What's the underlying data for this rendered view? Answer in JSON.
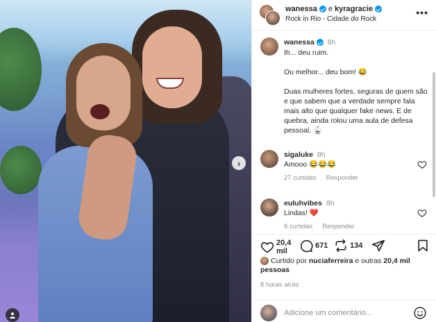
{
  "header": {
    "user1": "wanessa",
    "connector": "e",
    "user2": "kyragracie",
    "location": "Rock in Rio - Cidade do Rock",
    "more_icon": "more-horizontal-icon"
  },
  "caption": {
    "username": "wanessa",
    "time": "8h",
    "lines": [
      "Ih... deu ruim.",
      "Ou melhor... deu bom! 😂",
      "Duas mulheres fortes, seguras de quem são e que sabem que a verdade sempre fala mais alto que qualquer fake news. E de quebra, ainda rolou uma aula de defesa pessoal. 🥋"
    ]
  },
  "comments": [
    {
      "username": "sigaluke",
      "time": "8h",
      "text": "Amooo 😂😂😂",
      "likes": "27 curtidas",
      "reply": "Responder"
    },
    {
      "username": "euluhvibes",
      "time": "8h",
      "text": "Lindas! ❤️",
      "likes": "8 curtidas",
      "reply": "Responder"
    }
  ],
  "actions": {
    "likes_count": "20,4 mil",
    "comments_count": "671",
    "reposts_count": "134"
  },
  "liked_by": {
    "prefix": "Curtido por ",
    "user": "nuciaferreira",
    "middle": " e outras ",
    "count": "20,4 mil",
    "suffix": "pessoas"
  },
  "posted_ago": "8 horas atrás",
  "comment_input": {
    "placeholder": "Adicione um comentário..."
  },
  "colors": {
    "verified": "#0095f6",
    "heart": "#ff3040",
    "muted": "#8e8e8e"
  }
}
